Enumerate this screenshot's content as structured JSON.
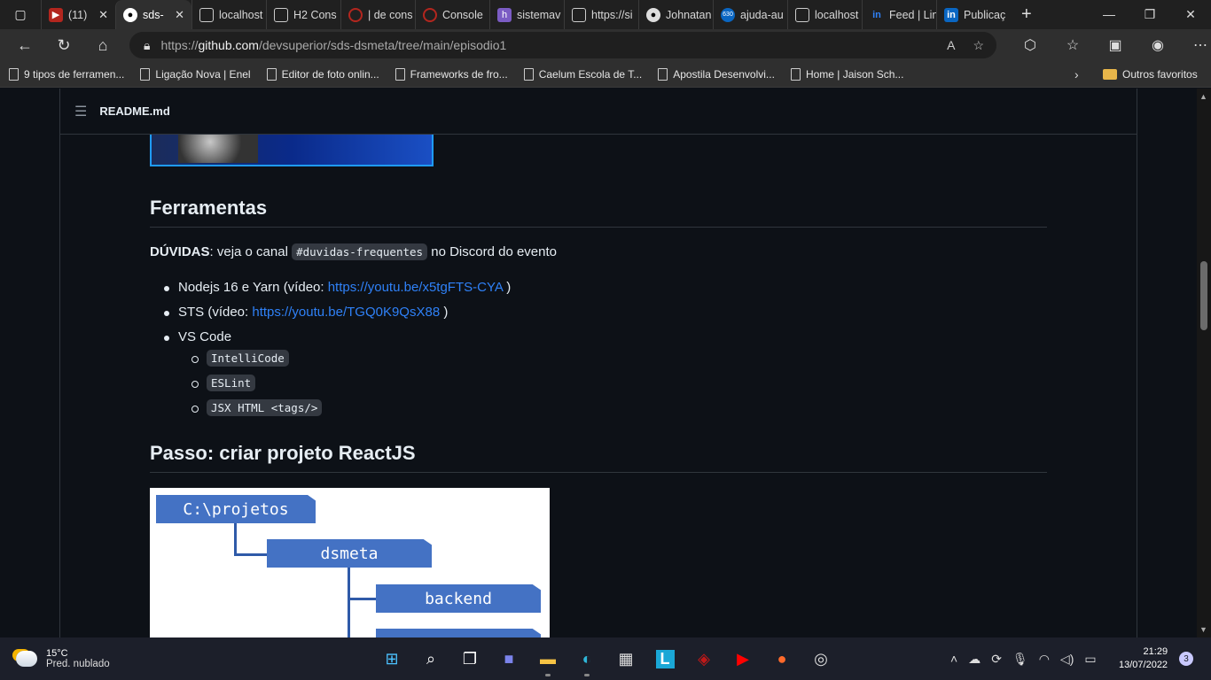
{
  "browser": {
    "tabs": [
      {
        "title": "(11)",
        "icon": "youtube-icon",
        "color": "#ff0000"
      },
      {
        "title": "sds-",
        "icon": "github-icon",
        "active": true
      },
      {
        "title": "localhost",
        "icon": "page-icon"
      },
      {
        "title": "H2 Cons",
        "icon": "page-icon"
      },
      {
        "title": "| de cons",
        "icon": "red-circle-icon",
        "color": "#b3261e"
      },
      {
        "title": "Console",
        "icon": "red-circle-icon",
        "color": "#b3261e"
      },
      {
        "title": "sistemav",
        "icon": "h-icon",
        "color": "#7b5cc4"
      },
      {
        "title": "https://si",
        "icon": "page-icon"
      },
      {
        "title": "Johnatan",
        "icon": "github-icon"
      },
      {
        "title": "ajuda-au",
        "icon": "badge-icon",
        "color": "#0a66c2",
        "badge": "630"
      },
      {
        "title": "localhost",
        "icon": "page-icon"
      },
      {
        "title": "Feed | Lin",
        "icon": "linkedin-icon",
        "color": "#0a66c2"
      },
      {
        "title": "Publicaç",
        "icon": "linkedin-icon",
        "color": "#0a66c2"
      }
    ],
    "url_prefix": "https://",
    "url_host": "github.com",
    "url_path": "/devsuperior/sds-dsmeta/tree/main/episodio1",
    "bookmarks": [
      "9 tipos de ferramen...",
      "Ligação Nova | Enel",
      "Editor de foto onlin...",
      "Frameworks de fro...",
      "Caelum Escola de T...",
      "Apostila Desenvolvi...",
      "Home | Jaison Sch..."
    ],
    "other_favorites": "Outros favoritos"
  },
  "readme": {
    "filename": "README.md",
    "h_tools": "Ferramentas",
    "duvidas_label": "DÚVIDAS",
    "duvidas_text": ": veja o canal ",
    "duvidas_channel": "#duvidas-frequentes",
    "duvidas_tail": " no Discord do evento",
    "items": [
      {
        "text": "Nodejs 16 e Yarn (vídeo: ",
        "link": "https://youtu.be/x5tgFTS-CYA",
        "tail": " )"
      },
      {
        "text": "STS (vídeo: ",
        "link": "https://youtu.be/TGQ0K9QsX88",
        "tail": " )"
      },
      {
        "text": "VS Code"
      }
    ],
    "vscode_ext": [
      "IntelliCode",
      "ESLint",
      "JSX HTML <tags/>"
    ],
    "h_step": "Passo: criar projeto ReactJS",
    "diagram": {
      "root": "C:\\projetos",
      "child": "dsmeta",
      "leaf": "backend"
    }
  },
  "taskbar": {
    "temp": "15°C",
    "weather": "Pred. nublado",
    "time": "21:29",
    "date": "13/07/2022",
    "notifications": "3"
  }
}
